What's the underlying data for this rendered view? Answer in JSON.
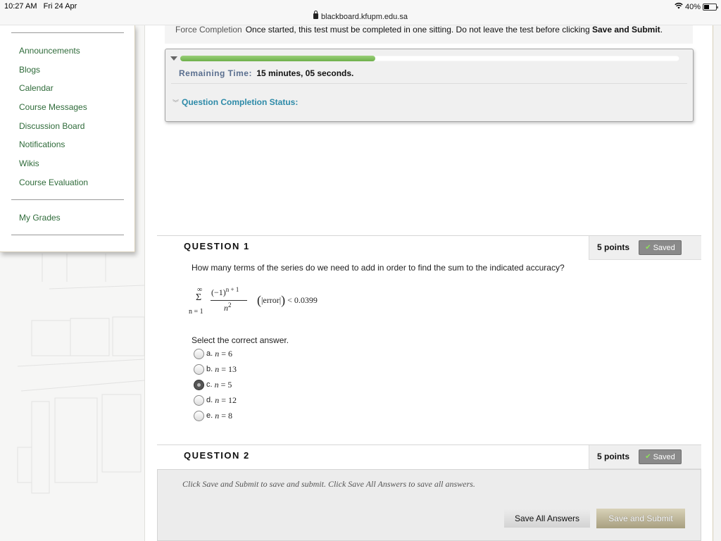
{
  "status_bar": {
    "time": "10:27 AM",
    "date": "Fri 24 Apr",
    "url": "blackboard.kfupm.edu.sa",
    "battery_percent": "40%",
    "icons": [
      "lock-icon",
      "wifi-icon",
      "battery-icon"
    ]
  },
  "sidebar": {
    "items": [
      {
        "label": "Announcements"
      },
      {
        "label": "Blogs"
      },
      {
        "label": "Calendar"
      },
      {
        "label": "Course Messages"
      },
      {
        "label": "Discussion Board"
      },
      {
        "label": "Notifications"
      },
      {
        "label": "Wikis"
      },
      {
        "label": "Course Evaluation"
      }
    ],
    "secondary_items": [
      {
        "label": "My Grades"
      }
    ]
  },
  "test_info": {
    "force_completion_label": "Force Completion",
    "force_completion_text": "Once started, this test must be completed in one sitting. Do not leave the test before clicking ",
    "force_completion_emphasis": "Save and Submit",
    "force_completion_end": "."
  },
  "timer": {
    "progress_fraction": 0.39,
    "remaining_label": "Remaining Time:",
    "remaining_value": "15 minutes, 05 seconds.",
    "completion_status_label": "Question Completion Status:",
    "colors": {
      "progress": "#7dbd5a",
      "label": "#5a6f8f",
      "status": "#2d8aa8"
    }
  },
  "questions": [
    {
      "title": "QUESTION 1",
      "points": "5 points",
      "saved_label": "Saved",
      "prompt": "How many terms of the series do we need to add in order to find the sum to the indicated accuracy?",
      "math": {
        "sum_symbol": "Σ",
        "upper": "∞",
        "lower": "n = 1",
        "numerator": "(−1)",
        "numerator_exp": "n + 1",
        "denominator": "n",
        "denominator_exp": "2",
        "condition_open": "(",
        "condition_text": "|error|",
        "condition_close": ")",
        "condition_bound": " < 0.0399"
      },
      "select_label": "Select the correct answer.",
      "options": [
        {
          "letter": "a.",
          "var": "n",
          "value": " = 6",
          "selected": false
        },
        {
          "letter": "b.",
          "var": "n",
          "value": " = 13",
          "selected": false
        },
        {
          "letter": "c.",
          "var": "n",
          "value": " = 5",
          "selected": true
        },
        {
          "letter": "d.",
          "var": "n",
          "value": " = 12",
          "selected": false
        },
        {
          "letter": "e.",
          "var": "n",
          "value": " = 8",
          "selected": false
        }
      ]
    },
    {
      "title": "QUESTION 2",
      "points": "5 points",
      "saved_label": "Saved"
    }
  ],
  "submit": {
    "hint": "Click Save and Submit to save and submit. Click Save All Answers to save all answers.",
    "save_all_label": "Save All Answers",
    "submit_label": "Save and Submit",
    "colors": {
      "submit_button": "#b8af90"
    }
  }
}
